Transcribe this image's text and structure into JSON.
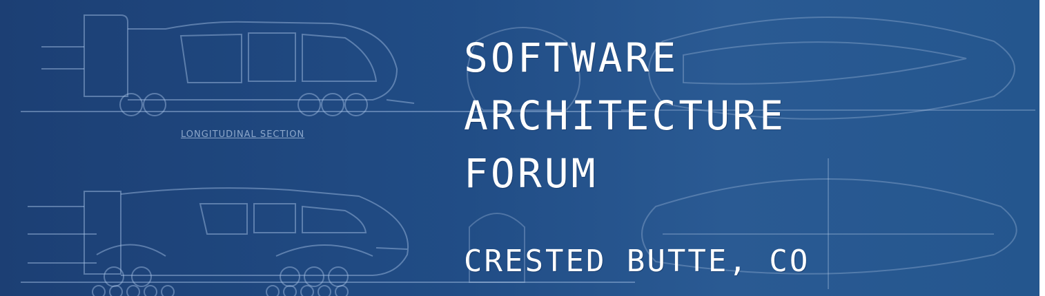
{
  "banner": {
    "title_lines": [
      "Software",
      "Architecture",
      "Forum"
    ],
    "location": "Crested Butte, CO",
    "background_color": "#1f4f86",
    "text_color": "#ffffff"
  },
  "blueprint": {
    "section_label": "LONGITUDINAL SECTION"
  }
}
